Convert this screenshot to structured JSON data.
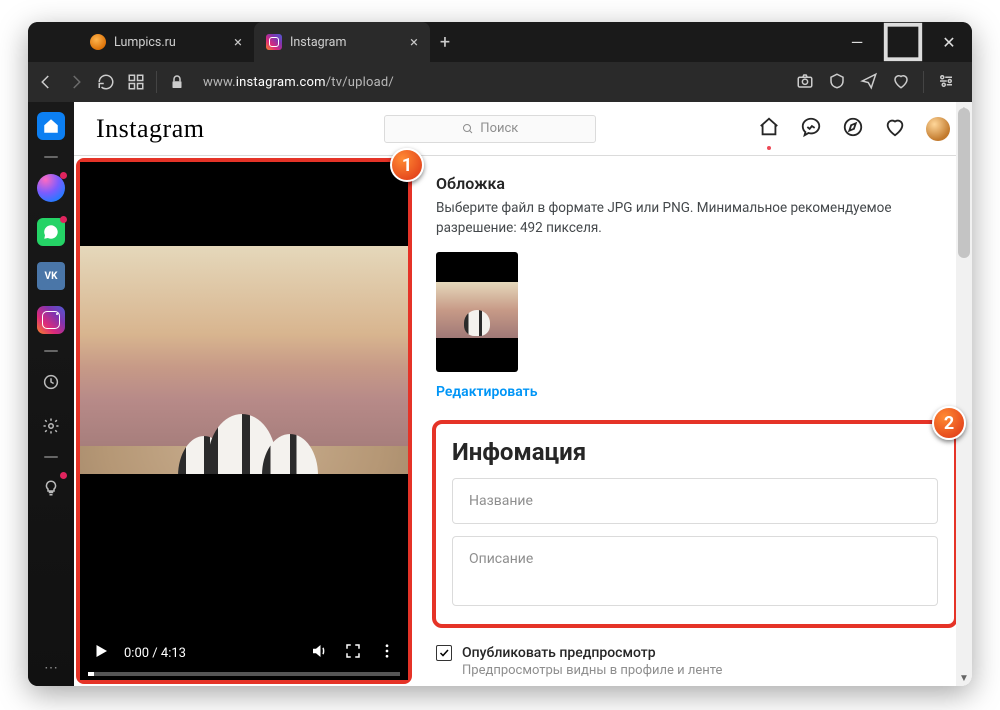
{
  "browser": {
    "tabs": [
      {
        "title": "Lumpics.ru",
        "active": false
      },
      {
        "title": "Instagram",
        "active": true
      }
    ],
    "newtab_plus": "+",
    "win_min": "—",
    "win_max": "▢",
    "win_close": "✕",
    "url_prefix": "www.",
    "url_domain": "instagram.com",
    "url_path": "/tv/upload/"
  },
  "sidebar": {
    "vk_label": "VK"
  },
  "instagram": {
    "logo": "Instagram",
    "search_placeholder": "Поиск",
    "sections": {
      "cover": {
        "heading": "Обложка",
        "help": "Выберите файл в формате JPG или PNG. Минимальное рекомендуемое разрешение: 492 пикселя.",
        "edit": "Редактировать"
      },
      "info": {
        "heading": "Инфомация",
        "title_placeholder": "Название",
        "desc_placeholder": "Описание"
      },
      "preview": {
        "label": "Опубликовать предпросмотр",
        "sub": "Предпросмотры видны в профиле и ленте",
        "checked": true
      }
    }
  },
  "video": {
    "current": "0:00",
    "duration": "4:13",
    "sep": " / "
  },
  "callouts": {
    "one": "1",
    "two": "2"
  }
}
